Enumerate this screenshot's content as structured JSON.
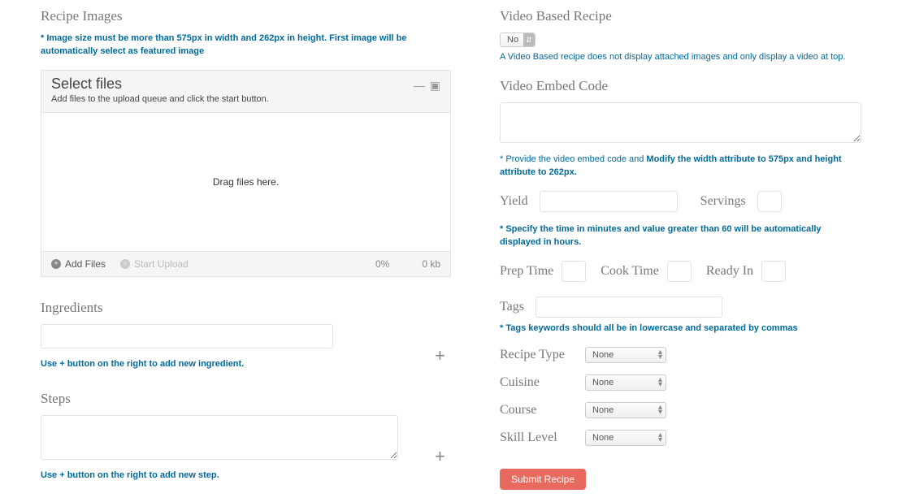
{
  "left": {
    "recipe_images_heading": "Recipe Images",
    "image_hint": "* Image size must be more than 575px in width and 262px in height. First image will be automatically select as featured image",
    "uploader": {
      "title": "Select files",
      "subtitle": "Add files to the upload queue and click the start button.",
      "drop_text": "Drag files here.",
      "add_files": "Add Files",
      "start_upload": "Start Upload",
      "progress": "0%",
      "size_total": "0 kb"
    },
    "ingredients_heading": "Ingredients",
    "ingredients_hint": "Use + button on the right to add new ingredient.",
    "steps_heading": "Steps",
    "steps_hint": "Use + button on the right to add new step."
  },
  "right": {
    "video_heading": "Video Based Recipe",
    "video_select_value": "No",
    "video_hint": "A Video Based recipe does not display attached images and only display a video at top.",
    "embed_heading": "Video Embed Code",
    "embed_hint_prefix": "* Provide the video embed code and ",
    "embed_hint_bold": "Modify the width attribute to 575px and height attribute to 262px.",
    "yield_label": "Yield",
    "servings_label": "Servings",
    "time_hint": "* Specify the time in minutes and value greater than 60 will be automatically displayed in hours.",
    "prep_label": "Prep Time",
    "cook_label": "Cook Time",
    "ready_label": "Ready In",
    "tags_label": "Tags",
    "tags_hint": "* Tags keywords should all be in lowercase and separated by commas",
    "recipe_type_label": "Recipe Type",
    "cuisine_label": "Cuisine",
    "course_label": "Course",
    "skill_label": "Skill Level",
    "select_none": "None",
    "submit_label": "Submit Recipe"
  }
}
